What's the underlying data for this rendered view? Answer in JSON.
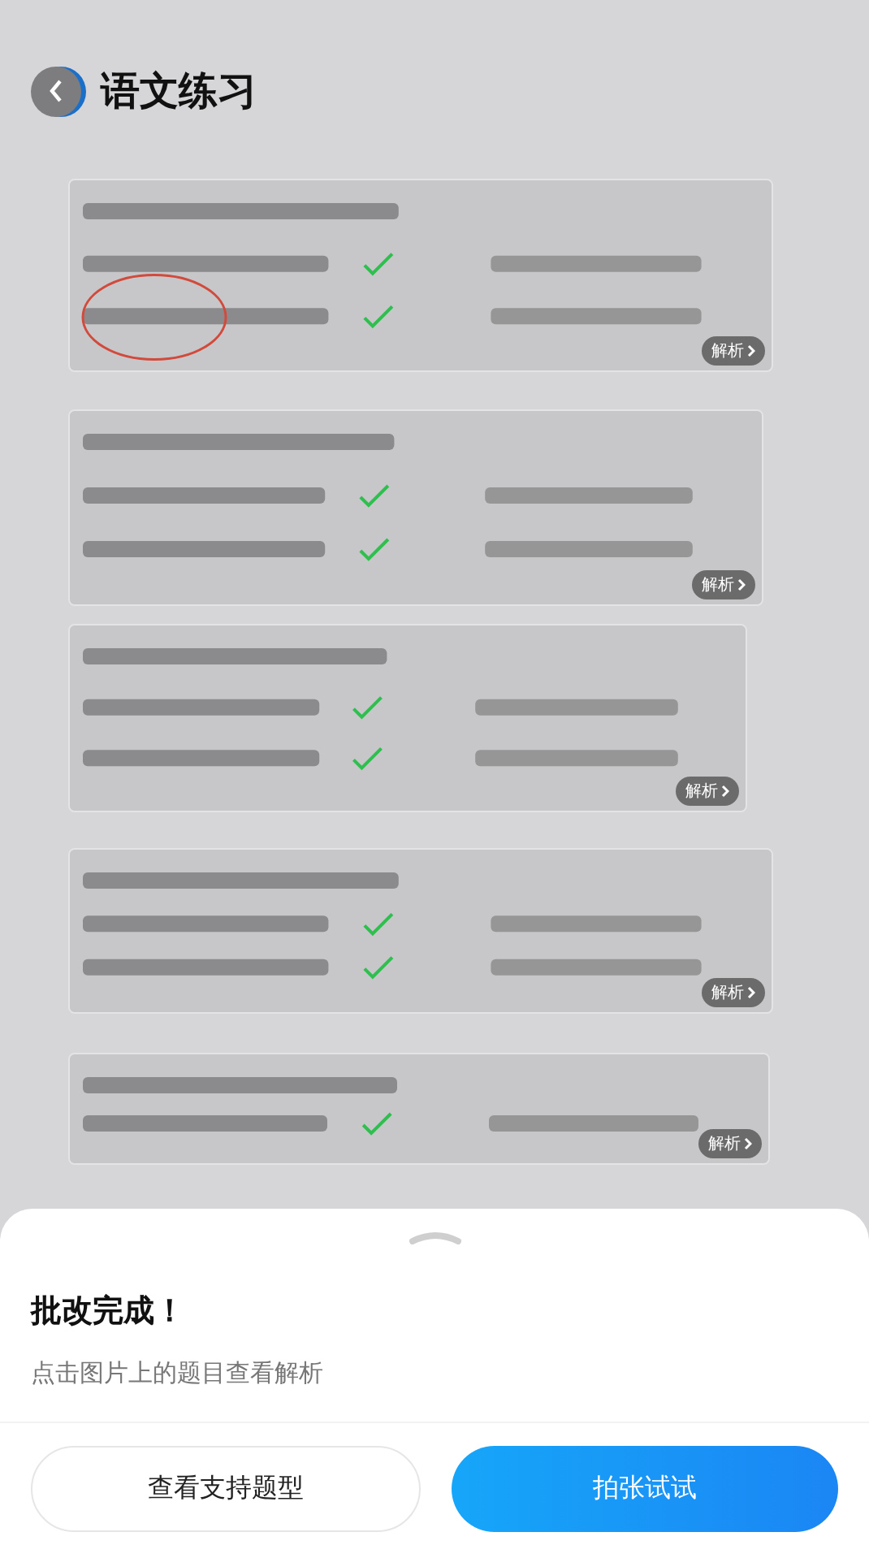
{
  "header": {
    "title": "语文练习"
  },
  "questions": [
    {
      "kind": "picture",
      "badge": "解析"
    },
    {
      "kind": "picture",
      "badge": "解析"
    },
    {
      "kind": "picture",
      "badge": "解析"
    },
    {
      "kind": "picture",
      "badge": "解析"
    },
    {
      "kind": "picture",
      "badge": "解析"
    }
  ],
  "sheet": {
    "title": "批改完成！",
    "hint": "点击图片上的题目查看解析",
    "buttons": [
      {
        "label": "查看支持题型",
        "kind": "secondary"
      },
      {
        "label": "拍张试试",
        "kind": "primary"
      }
    ]
  }
}
